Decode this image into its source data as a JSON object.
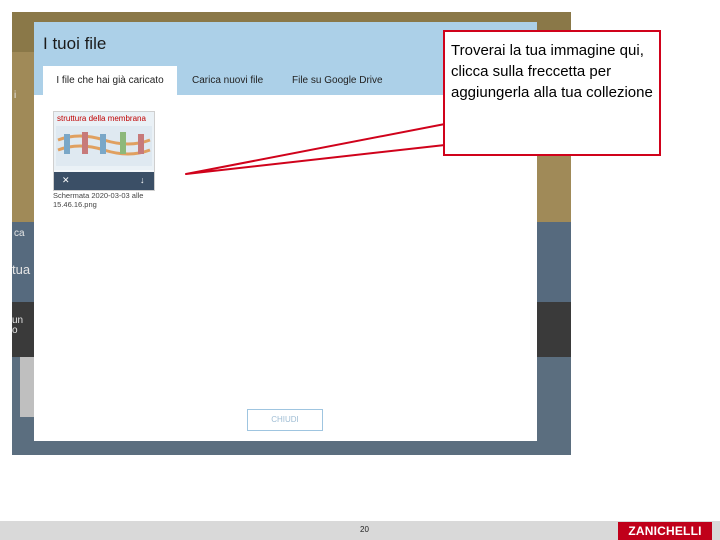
{
  "background_page": {
    "left_text_1": "ca",
    "left_text_2": "tua",
    "left_text_3": "un",
    "left_text_4": "o",
    "left_text_5": "i"
  },
  "modal": {
    "title": "I tuoi file",
    "tabs": [
      {
        "label": "I file che hai già caricato",
        "active": true
      },
      {
        "label": "Carica nuovi file",
        "active": false
      },
      {
        "label": "File su Google Drive",
        "active": false
      }
    ],
    "file": {
      "thumbnail_title": "struttura della membrana",
      "name": "Schermata 2020-03-03 alle 15.46.16.png",
      "delete_icon": "✕",
      "download_icon": "↓"
    },
    "close_label": "CHIUDI"
  },
  "callout": {
    "text": "Troverai la tua immagine qui, clicca sulla freccetta per aggiungerla alla tua collezione",
    "border_color": "#d0021b"
  },
  "footer": {
    "page_number": "20",
    "logo_text": "ZANICHELLI"
  }
}
